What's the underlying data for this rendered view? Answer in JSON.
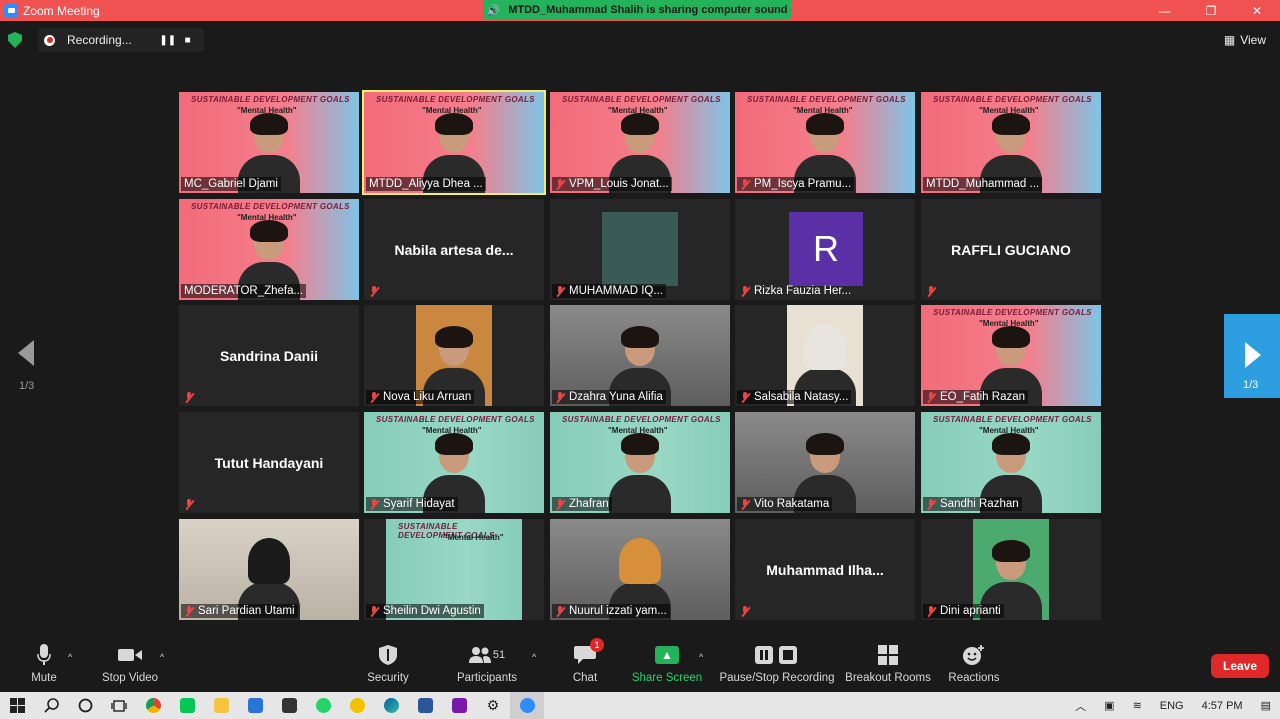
{
  "window": {
    "title": "Zoom Meeting",
    "sharing_banner": "MTDD_Muhammad Shalih is sharing computer sound",
    "minimize": "—",
    "restore": "❐",
    "close": "✕"
  },
  "recording": {
    "status": "Recording...",
    "pause": "❚❚",
    "stop": "■"
  },
  "view_label": "View",
  "slide_text": {
    "title": "SUSTAINABLE DEVELOPMENT GOALS",
    "subtitle": "\"Mental Health\""
  },
  "participants": [
    {
      "name": "MC_Gabriel Djami",
      "muted": false,
      "type": "video",
      "bg": "pink"
    },
    {
      "name": "MTDD_Aliyya Dhea ...",
      "muted": false,
      "type": "video",
      "bg": "pink",
      "active": true
    },
    {
      "name": "VPM_Louis Jonat...",
      "muted": true,
      "type": "video",
      "bg": "pink"
    },
    {
      "name": "PM_Iscya Pramu...",
      "muted": true,
      "type": "video",
      "bg": "pink"
    },
    {
      "name": "MTDD_Muhammad ...",
      "muted": false,
      "type": "video",
      "bg": "pink"
    },
    {
      "name": "MODERATOR_Zhefa...",
      "muted": false,
      "type": "video",
      "bg": "pink"
    },
    {
      "name": "Nabila artesa de...",
      "muted": true,
      "type": "name"
    },
    {
      "name": "MUHAMMAD IQ...",
      "muted": true,
      "type": "video",
      "bg": "inset"
    },
    {
      "name": "Rizka Fauzia Her...",
      "muted": true,
      "type": "avatar",
      "initial": "R"
    },
    {
      "name": "RAFFLI GUCIANO",
      "muted": true,
      "type": "name"
    },
    {
      "name": "Sandrina Danii",
      "muted": true,
      "type": "name"
    },
    {
      "name": "Nova Liku Arruan",
      "muted": true,
      "type": "video",
      "bg": "inset-orange"
    },
    {
      "name": "Dzahra Yuna Alifia",
      "muted": true,
      "type": "video",
      "bg": "room"
    },
    {
      "name": "Salsabila Natasy...",
      "muted": true,
      "type": "video",
      "bg": "inset-beige"
    },
    {
      "name": "EO_Fatih Razan",
      "muted": true,
      "type": "video",
      "bg": "pink"
    },
    {
      "name": "Tutut Handayani",
      "muted": true,
      "type": "name"
    },
    {
      "name": "Syarif Hidayat",
      "muted": true,
      "type": "video",
      "bg": "teal"
    },
    {
      "name": "Zhafran",
      "muted": true,
      "type": "video",
      "bg": "teal"
    },
    {
      "name": "Vito Rakatama",
      "muted": true,
      "type": "video",
      "bg": "room"
    },
    {
      "name": "Sandhi Razhan",
      "muted": true,
      "type": "video",
      "bg": "teal"
    },
    {
      "name": "Sari Pardian Utami",
      "muted": true,
      "type": "video",
      "bg": "beige"
    },
    {
      "name": "Sheilin Dwi Agustin",
      "muted": true,
      "type": "video",
      "bg": "teal-slide"
    },
    {
      "name": "Nuurul izzati yam...",
      "muted": true,
      "type": "video",
      "bg": "room"
    },
    {
      "name": "Muhammad  Ilha...",
      "muted": true,
      "type": "name"
    },
    {
      "name": "Dini aprianti",
      "muted": true,
      "type": "video",
      "bg": "inset-green"
    }
  ],
  "pager": {
    "left": "1/3",
    "right": "1/3"
  },
  "toolbar": {
    "mute": "Mute",
    "stop_video": "Stop Video",
    "security": "Security",
    "participants": "Participants",
    "participants_count": "51",
    "chat": "Chat",
    "chat_badge": "1",
    "share_screen": "Share Screen",
    "pause_stop_recording": "Pause/Stop Recording",
    "breakout_rooms": "Breakout Rooms",
    "reactions": "Reactions",
    "leave": "Leave",
    "caret": "^"
  },
  "taskbar": {
    "language": "ENG",
    "time": "4:57 PM"
  },
  "colors": {
    "titlebar": "#f05252",
    "share_banner": "#23b35b",
    "active_speaker": "#f2ee6a",
    "leave": "#e02828",
    "pager_accent": "#2d9ee0"
  }
}
